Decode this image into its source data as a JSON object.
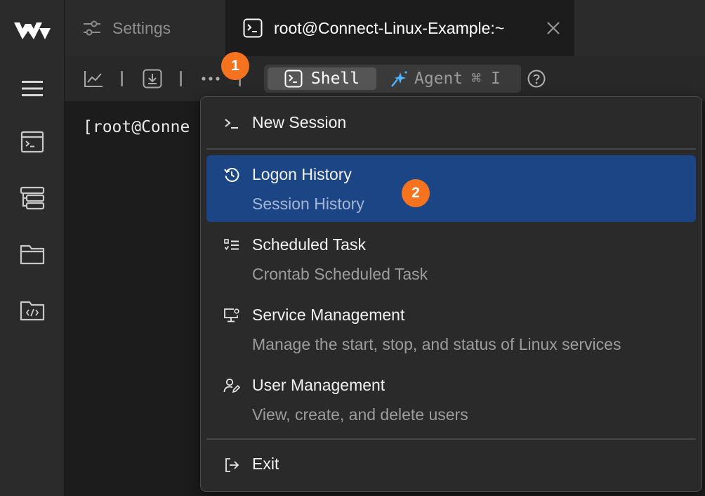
{
  "tabs": {
    "settings_label": "Settings",
    "terminal_label": "root@Connect-Linux-Example:~"
  },
  "toolbar": {
    "shell_label": "Shell",
    "agent_label": "Agent",
    "agent_shortcut": "⌘ I"
  },
  "terminal": {
    "prompt_text": "[root@Conne"
  },
  "badges": {
    "step1": "1",
    "step2": "2"
  },
  "menu": {
    "new_session": "New Session",
    "items": [
      {
        "title": "Logon History",
        "desc": "Session History",
        "icon": "history-icon"
      },
      {
        "title": "Scheduled Task",
        "desc": "Crontab Scheduled Task",
        "icon": "task-list-icon"
      },
      {
        "title": "Service Management",
        "desc": "Manage the start, stop, and status of Linux services",
        "icon": "monitor-gear-icon"
      },
      {
        "title": "User Management",
        "desc": "View, create, and delete users",
        "icon": "user-edit-icon"
      }
    ],
    "exit": "Exit"
  },
  "colors": {
    "accent_badge": "#f5731e",
    "menu_highlight": "#1b4584",
    "background": "#1c1c1c"
  }
}
